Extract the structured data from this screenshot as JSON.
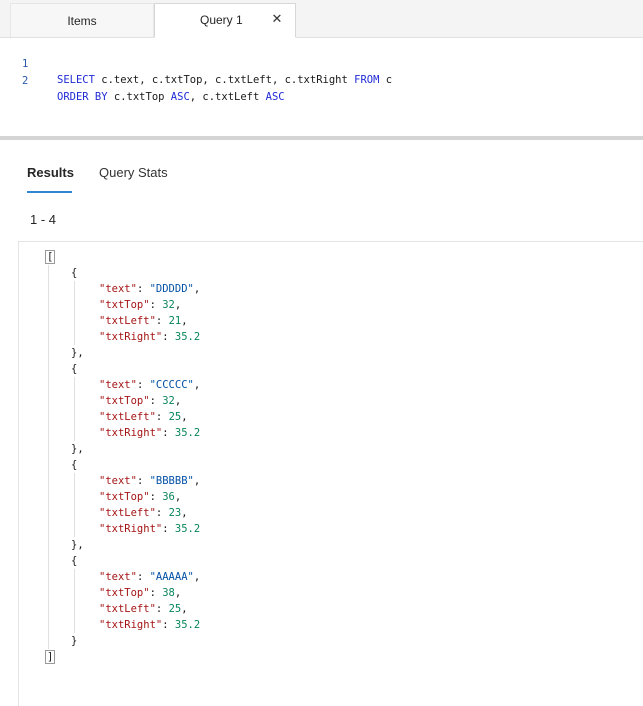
{
  "tabs": {
    "items_label": "Items",
    "query_label": "Query 1",
    "close_glyph": "✕"
  },
  "editor": {
    "lines": [
      {
        "number": "1",
        "segments": [
          {
            "text": "SELECT",
            "kw": true
          },
          {
            "text": " c.text, c.txtTop, c.txtLeft, c.txtRight ",
            "kw": false
          },
          {
            "text": "FROM",
            "kw": true
          },
          {
            "text": " c",
            "kw": false
          }
        ]
      },
      {
        "number": "2",
        "segments": [
          {
            "text": "ORDER BY",
            "kw": true
          },
          {
            "text": " c.txtTop ",
            "kw": false
          },
          {
            "text": "ASC",
            "kw": true
          },
          {
            "text": ", c.txtLeft ",
            "kw": false
          },
          {
            "text": "ASC",
            "kw": true
          }
        ]
      }
    ]
  },
  "results": {
    "tab_results": "Results",
    "tab_stats": "Query Stats",
    "range": "1 - 4",
    "documents": [
      {
        "text": "DDDDD",
        "txtTop": 32,
        "txtLeft": 21,
        "txtRight": 35.2
      },
      {
        "text": "CCCCC",
        "txtTop": 32,
        "txtLeft": 25,
        "txtRight": 35.2
      },
      {
        "text": "BBBBB",
        "txtTop": 36,
        "txtLeft": 23,
        "txtRight": 35.2
      },
      {
        "text": "AAAAA",
        "txtTop": 38,
        "txtLeft": 25,
        "txtRight": 35.2
      }
    ]
  },
  "colors": {
    "keyword": "#1f2bd6",
    "json_key": "#a31515",
    "json_string": "#0451a5",
    "json_number": "#098658",
    "active_tab_underline": "#2f86d3"
  }
}
